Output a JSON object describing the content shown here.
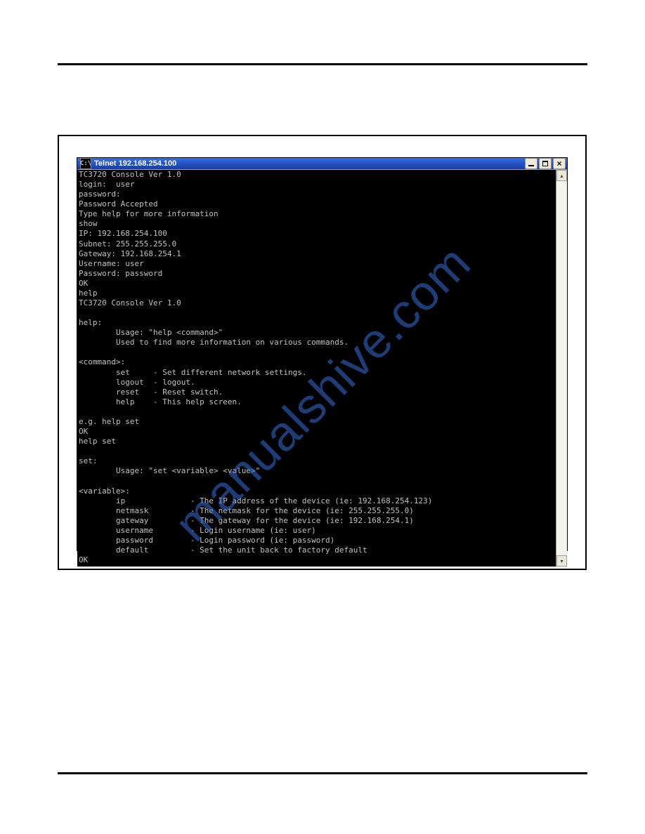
{
  "window": {
    "title": "Telnet 192.168.254.100",
    "title_icon_label": "cmd-icon",
    "title_icon_text": "C:\\",
    "buttons": {
      "minimize_name": "minimize-button",
      "maximize_name": "maximize-button",
      "close_name": "close-button"
    }
  },
  "scrollbar": {
    "up_name": "scroll-up-button",
    "down_name": "scroll-down-button",
    "track_name": "scrollbar-track"
  },
  "terminal_text": "TC3720 Console Ver 1.0\nlogin:  user\npassword:\nPassword Accepted\nType help for more information\nshow\nIP: 192.168.254.100\nSubnet: 255.255.255.0\nGateway: 192.168.254.1\nUsername: user\nPassword: password\nOK\nhelp\nTC3720 Console Ver 1.0\n\nhelp:\n        Usage: \"help <command>\"\n        Used to find more information on various commands.\n\n<command>:\n        set     - Set different network settings.\n        logout  - logout.\n        reset   - Reset switch.\n        help    - This help screen.\n\ne.g. help set\nOK\nhelp set\n\nset:\n        Usage: \"set <variable> <value>\"\n\n<variable>:\n        ip              - The IP address of the device (ie: 192.168.254.123)\n        netmask         - The netmask for the device (ie: 255.255.255.0)\n        gateway         - The gateway for the device (ie: 192.168.254.1)\n        username        - Login username (ie: user)\n        password        - Login password (ie: password)\n        default         - Set the unit back to factory default\nOK",
  "watermark": "manualshive.com"
}
